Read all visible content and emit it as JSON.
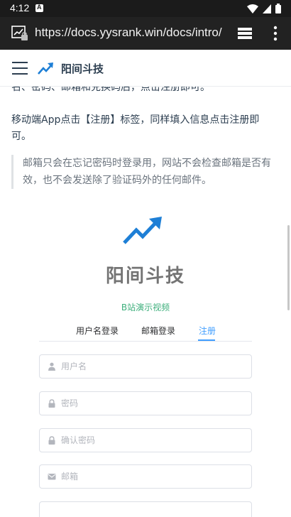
{
  "status_bar": {
    "time": "4:12"
  },
  "browser": {
    "url": "https://docs.yysrank.win/docs/intro/"
  },
  "header": {
    "title": "阳间斗技"
  },
  "article": {
    "cut_line": "名、密码、邮箱和兑换码后，点击注册即可。",
    "paragraph": "移动端App点击【注册】标签，同样填入信息点击注册即可。",
    "quote": "邮箱只会在忘记密码时登录用，网站不会检查邮箱是否有效，也不会发送除了验证码外的任何邮件。"
  },
  "demo": {
    "title": "阳间斗技",
    "video_link": "B站演示视频",
    "tabs": [
      {
        "label": "用户名登录"
      },
      {
        "label": "邮箱登录"
      },
      {
        "label": "注册"
      }
    ],
    "active_tab": "注册",
    "fields": {
      "username_placeholder": "用户名",
      "password_placeholder": "密码",
      "confirm_placeholder": "确认密码",
      "email_placeholder": "邮箱"
    }
  },
  "colors": {
    "accent": "#409eff",
    "brand": "#3eaf7c",
    "icon_blue": "#1e7fd6"
  }
}
